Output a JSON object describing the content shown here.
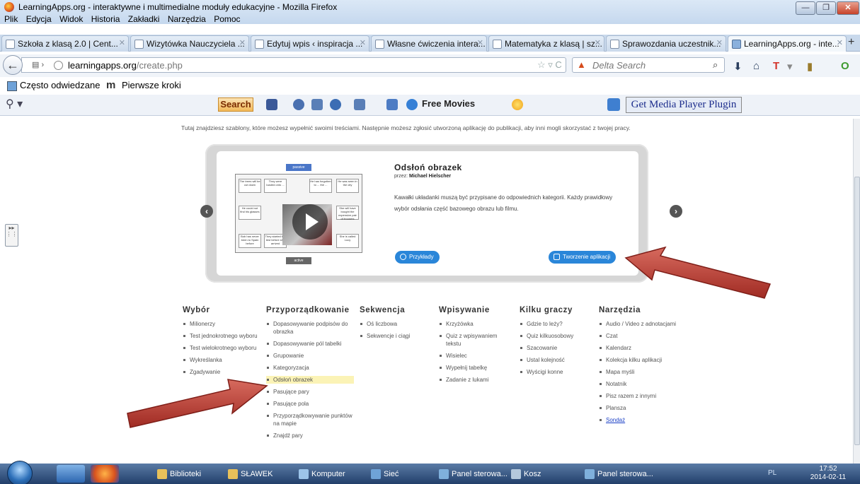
{
  "window": {
    "title": "LearningApps.org - interaktywne i multimedialne moduły edukacyjne - Mozilla Firefox"
  },
  "menu": [
    "Plik",
    "Edycja",
    "Widok",
    "Historia",
    "Zakładki",
    "Narzędzia",
    "Pomoc"
  ],
  "tabs": [
    {
      "label": "Szkoła z klasą 2.0 | Cent..."
    },
    {
      "label": "Wizytówka Nauczyciela ..."
    },
    {
      "label": "Edytuj wpis ‹ inspiracja ..."
    },
    {
      "label": "Własne ćwiczenia intera..."
    },
    {
      "label": "Matematyka z klasą | sz..."
    },
    {
      "label": "Sprawozdania uczestnik..."
    },
    {
      "label": "LearningApps.org - inte..."
    }
  ],
  "nav": {
    "url_host": "learningapps.org",
    "url_path": "/create.php",
    "search_placeholder": "Delta Search"
  },
  "bookmarks": [
    "Często odwiedzane",
    "Pierwsze kroki"
  ],
  "toolbar2": {
    "search_label": "Search",
    "free_movies": "Free Movies",
    "media_plugin": "Get Media Player Plugin"
  },
  "content": {
    "intro": "Tutaj znajdziesz szablony, które możesz wypełnić swoimi treściami. Następnie możesz zgłosić utworzoną aplikację do publikacji, aby inni mogli skorzystać z twojej pracy.",
    "app": {
      "title": "Odsłoń obrazek",
      "author_prefix": "przez:",
      "author": "Michael Hielscher",
      "description": "Kawałki układanki muszą być przypisane do odpowiednich kategorii. Każdy prawidłowy wybór odsłania część bazowego obrazu lub filmu.",
      "examples_button": "Przykłady",
      "create_button": "Tworzenie aplikacji",
      "thumb_top": "passive",
      "thumb_bottom": "active",
      "thumb_cells": [
        "The trees will be cut down",
        "They were loaded onto ...",
        "He has forgotten to ... the ...",
        "He was seen in the city",
        "He could not find his glasses",
        "She will have bought the expensive pair of trousers",
        "Bob has never been to Spain before",
        "They started the test before she arrived",
        "She is called Lucy"
      ]
    },
    "categories": [
      {
        "title": "Wybór",
        "items": [
          "Milionerzy",
          "Test jednokrotnego wyboru",
          "Test wielokrotnego wyboru",
          "Wykreślanka",
          "Zgadywanie"
        ]
      },
      {
        "title": "Przyporządkowanie",
        "items": [
          "Dopasowywanie podpisów do obrazka",
          "Dopasowywanie pól tabelki",
          "Grupowanie",
          "Kategoryzacja",
          "Odsłoń obrazek",
          "Pasujące pary",
          "Pasujące pola",
          "Przyporządkowywanie punktów na mapie",
          "Znajdź pary"
        ]
      },
      {
        "title": "Sekwencja",
        "items": [
          "Oś liczbowa",
          "Sekwencje i ciągi"
        ]
      },
      {
        "title": "Wpisywanie",
        "items": [
          "Krzyżówka",
          "Quiz z wpisywaniem tekstu",
          "Wisielec",
          "Wypełnij tabelkę",
          "Zadanie z lukami"
        ]
      },
      {
        "title": "Kilku graczy",
        "items": [
          "Gdzie to leży?",
          "Quiz kilkuosobowy",
          "Szacowanie",
          "Ustal kolejność",
          "Wyścigi konne"
        ]
      },
      {
        "title": "Narzędzia",
        "items": [
          "Audio / Video z adnotacjami",
          "Czat",
          "Kalendarz",
          "Kolekcja kilku aplikacji",
          "Mapa myśli",
          "Notatnik",
          "Pisz razem z innymi",
          "Plansza",
          "Sondaż"
        ]
      }
    ]
  },
  "taskbar": {
    "items": [
      "Biblioteki",
      "SŁAWEK",
      "Komputer",
      "Sieć",
      "Panel sterowa...",
      "Kosz",
      "Panel sterowa..."
    ],
    "lang": "PL",
    "time": "17:52",
    "date": "2014-02-11"
  },
  "colors": {
    "accent_blue": "#2a86d9",
    "arrow_red": "#b83a31",
    "highlight": "#fbf3b6"
  }
}
